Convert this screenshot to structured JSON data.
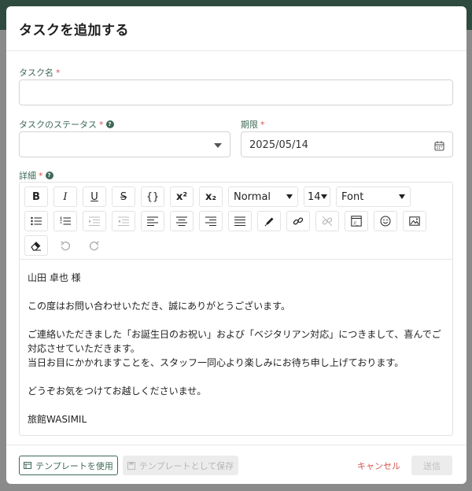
{
  "modal": {
    "title": "タスクを追加する"
  },
  "task_name": {
    "label": "タスク名",
    "required_mark": "*",
    "value": ""
  },
  "task_status": {
    "label": "タスクのステータス",
    "required_mark": "*",
    "help": "?",
    "value": ""
  },
  "due_date": {
    "label": "期限",
    "required_mark": "*",
    "value": "2025/05/14"
  },
  "details": {
    "label": "詳細",
    "required_mark": "*",
    "help": "?"
  },
  "toolbar": {
    "bold": "B",
    "italic": "I",
    "underline": "U",
    "strike": "S",
    "code": "{}",
    "superscript": "x²",
    "subscript": "x₂",
    "block_style": "Normal",
    "font_size": "14",
    "font": "Font"
  },
  "editor_content": {
    "line1": "山田 卓也 様",
    "line2": "この度はお問い合わせいただき、誠にありがとうございます。",
    "line3": "ご連絡いただきました「お誕生日のお祝い」および「ベジタリアン対応」につきまして、喜んでご対応させていただきます。",
    "line4": "当日お目にかかれますことを、スタッフ一同心より楽しみにお待ち申し上げております。",
    "line5": "どうぞお気をつけてお越しくださいませ。",
    "line6": "旅館WASIMIL"
  },
  "footer": {
    "use_template": "テンプレートを使用",
    "save_template": "テンプレートとして保存",
    "cancel": "キャンセル",
    "submit": "送信"
  },
  "colors": {
    "accent": "#3e6a57",
    "danger": "#d9534f"
  }
}
